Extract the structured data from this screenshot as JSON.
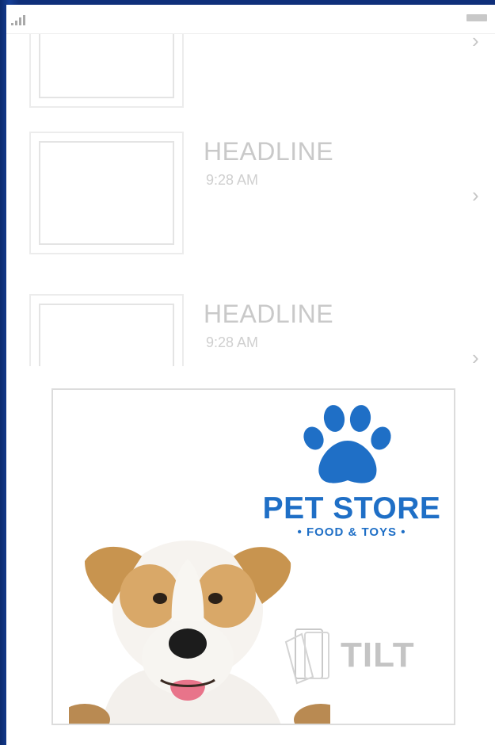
{
  "status_bar": {
    "signal_icon": "signal-bars-icon",
    "battery_icon": "battery-icon"
  },
  "feed": {
    "items": [
      {
        "headline": "",
        "time": ""
      },
      {
        "headline": "HEADLINE",
        "time": "9:28 AM"
      },
      {
        "headline": "HEADLINE",
        "time": "9:28 AM"
      }
    ],
    "chevron_icon": "chevron-right-icon"
  },
  "ad": {
    "brand_name": "PET STORE",
    "tagline": "• FOOD & TOYS •",
    "tilt_label": "TILT",
    "brand_color": "#1f6fc6",
    "logo_icon": "paw-print-icon",
    "tilt_icon": "tilt-phone-icon"
  }
}
